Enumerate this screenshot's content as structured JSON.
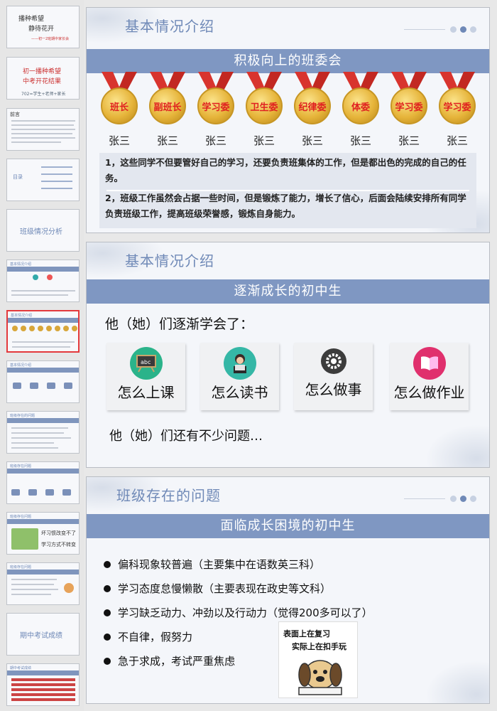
{
  "thumbnails": [
    {
      "title": "播种希望",
      "subtitle": "静待花开",
      "small": "——初一2班期中家长会"
    },
    {
      "title": "初一播种希望",
      "subtitle": "中考开花结果",
      "small": "702=学生+老师+家长"
    },
    {
      "title": "前言"
    },
    {
      "title": "目录"
    },
    {
      "title": "班级情况分析"
    },
    {
      "title": "基本情况介绍"
    },
    {
      "title": "基本情况介绍"
    },
    {
      "title": "基本情况介绍"
    },
    {
      "title": "班级存在的问题"
    },
    {
      "title": "班级存在问题"
    },
    {
      "title": "班级存在问题",
      "line1": "坏习惯改变不了",
      "line2": "学习方式不转变"
    },
    {
      "title": "班级存在问题"
    },
    {
      "title": "期中考试成绩"
    },
    {
      "title": "期中考试成绩"
    }
  ],
  "slide1": {
    "title": "基本情况介绍",
    "banner": "积极向上的班委会",
    "medals": [
      {
        "role": "班长",
        "name": "张三"
      },
      {
        "role": "副班长",
        "name": "张三"
      },
      {
        "role": "学习委",
        "name": "张三"
      },
      {
        "role": "卫生委",
        "name": "张三"
      },
      {
        "role": "纪律委",
        "name": "张三"
      },
      {
        "role": "体委",
        "name": "张三"
      },
      {
        "role": "学习委",
        "name": "张三"
      },
      {
        "role": "学习委",
        "name": "张三"
      }
    ],
    "para1": "1，这些同学不但要管好自己的学习，还要负责班集体的工作，但是都出色的完成的自己的任务。",
    "para2": "2，班级工作虽然会占据一些时间，但是锻炼了能力，增长了信心，后面会陆续安排所有同学负责班级工作，提高班级荣誉感，锻炼自身能力。"
  },
  "slide2": {
    "title": "基本情况介绍",
    "banner": "逐渐成长的初中生",
    "line1": "他（她）们逐渐学会了：",
    "cards": [
      {
        "label": "怎么上课",
        "icon": "blackboard-icon",
        "color": "#2bb38a"
      },
      {
        "label": "怎么读书",
        "icon": "reading-icon",
        "color": "#35b7a6"
      },
      {
        "label": "怎么做事",
        "icon": "gear-icon",
        "color": "#3c3c3c"
      },
      {
        "label": "怎么做作业",
        "icon": "book-icon",
        "color": "#e0306d"
      }
    ],
    "line2": "他（她）们还有不少问题…"
  },
  "slide3": {
    "title": "班级存在的问题",
    "banner": "面临成长困境的初中生",
    "bullets": [
      "偏科现象较普遍（主要集中在语数英三科）",
      "学习态度怠慢懒散（主要表现在政史等文科）",
      "学习缺乏动力、冲劲以及行动力（觉得200多可以了）",
      "不自律，假努力",
      "急于求成，考试严重焦虑"
    ],
    "cartoon_line1": "表面上在复习",
    "cartoon_line2": "实际上在扣手玩"
  },
  "colors": {
    "accent": "#7f97c2",
    "title": "#6f89b7",
    "medal_text": "#e02020",
    "ribbon": "#d8342e"
  }
}
